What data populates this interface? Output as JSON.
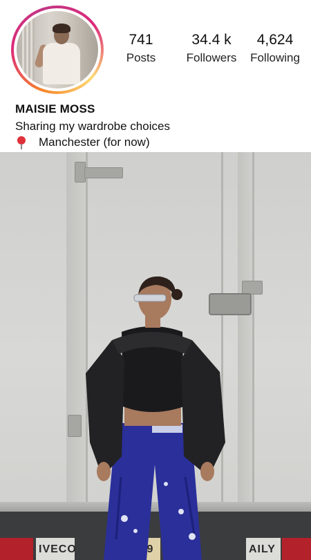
{
  "profile": {
    "name": "MAISIE MOSS",
    "bio": "Sharing my wardrobe choices",
    "location": "Manchester (for now)",
    "location_icon": "round-pushpin-icon"
  },
  "stats": {
    "posts": {
      "value": "741",
      "label": "Posts"
    },
    "followers": {
      "value": "34.4 k",
      "label": "Followers"
    },
    "following": {
      "value": "4,624",
      "label": "Following"
    }
  },
  "post": {
    "plate_left": "IVECO",
    "plate_mid": "N09",
    "plate_right": "AILY"
  },
  "colors": {
    "story_ring": "#dd2a7b",
    "jacket": "#1d1d1f",
    "pants": "#2a2f9a"
  }
}
